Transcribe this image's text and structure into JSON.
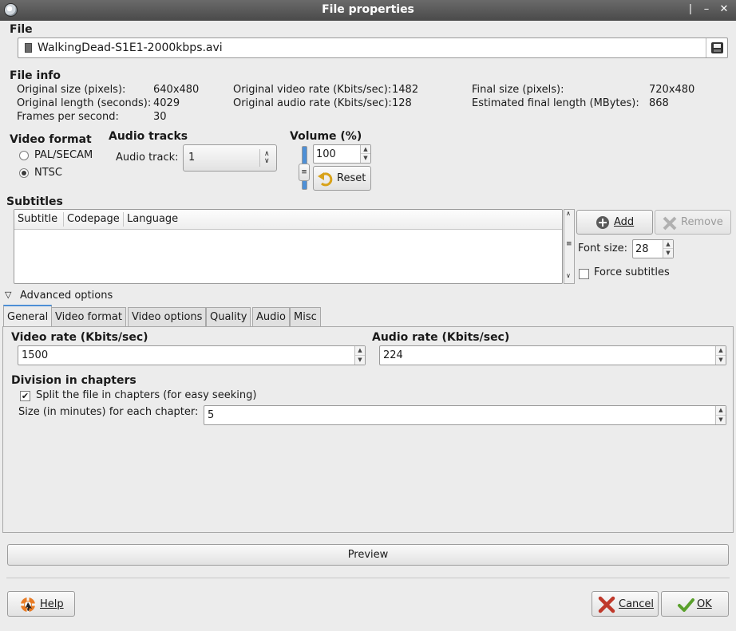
{
  "window": {
    "title": "File properties"
  },
  "file": {
    "section_title": "File",
    "filename": "WalkingDead-S1E1-2000kbps.avi"
  },
  "file_info": {
    "section_title": "File info",
    "original_size_label": "Original size (pixels):",
    "original_size_value": "640x480",
    "original_length_label": "Original length (seconds):",
    "original_length_value": "4029",
    "fps_label": "Frames per second:",
    "fps_value": "30",
    "orig_video_rate_label": "Original video rate (Kbits/sec):",
    "orig_video_rate_value": "1482",
    "orig_audio_rate_label": "Original audio rate (Kbits/sec):",
    "orig_audio_rate_value": "128",
    "final_size_label": "Final size (pixels):",
    "final_size_value": "720x480",
    "est_length_label": "Estimated final length (MBytes):",
    "est_length_value": "868"
  },
  "video_format": {
    "section_title": "Video format",
    "options": [
      "PAL/SECAM",
      "NTSC"
    ],
    "selected": "NTSC"
  },
  "audio_tracks": {
    "section_title": "Audio tracks",
    "track_label": "Audio track:",
    "track_value": "1"
  },
  "volume": {
    "section_title": "Volume (%)",
    "value": "100",
    "reset_label": "Reset",
    "level": 1.0
  },
  "subtitles": {
    "section_title": "Subtitles",
    "columns": [
      "Subtitle",
      "Codepage",
      "Language"
    ],
    "add_label": "Add",
    "remove_label": "Remove",
    "font_size_label": "Font size:",
    "font_size_value": "28",
    "force_label": "Force subtitles",
    "force_checked": false
  },
  "advanced": {
    "label": "Advanced options",
    "tabs": [
      "General",
      "Video format",
      "Video options",
      "Quality",
      "Audio",
      "Misc"
    ],
    "active_tab": "General",
    "video_rate_label": "Video rate (Kbits/sec)",
    "video_rate_value": "1500",
    "audio_rate_label": "Audio rate (Kbits/sec)",
    "audio_rate_value": "224",
    "chapters_title": "Division in chapters",
    "split_label": "Split the file in chapters (for easy seeking)",
    "split_checked": true,
    "chapter_size_label": "Size (in minutes) for each chapter:",
    "chapter_size_value": "5"
  },
  "buttons": {
    "preview": "Preview",
    "help": "Help",
    "cancel": "Cancel",
    "ok": "OK"
  },
  "colors": {
    "titlebar": "#4a4a4a",
    "tab_accent": "#4d8fd6",
    "ok_check": "#5aa02c",
    "cancel_x": "#c0392b"
  }
}
